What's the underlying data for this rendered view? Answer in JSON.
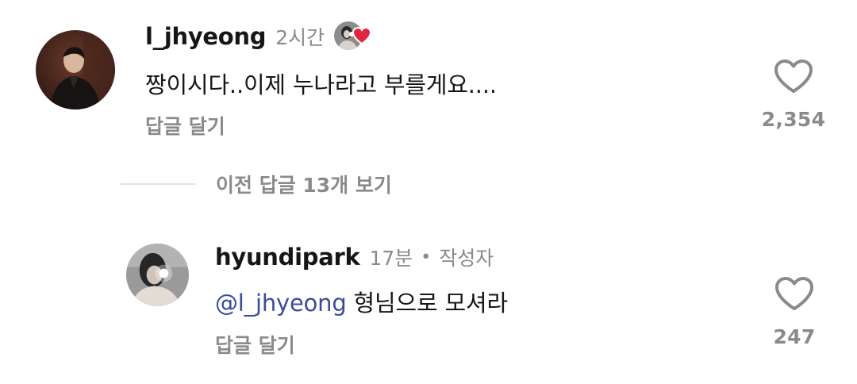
{
  "comment": {
    "username": "l_jhyeong",
    "time": "2시간",
    "text": "짱이시다..이제 누나라고 부를게요....",
    "reply_label": "답글 달기",
    "like_count": "2,354",
    "creator_liked_icon": "heart-icon"
  },
  "more_replies": {
    "label": "이전 답글 13개 보기"
  },
  "reply": {
    "username": "hyundipark",
    "time": "17분",
    "separator": "•",
    "author_tag": "작성자",
    "mention": "@l_jhyeong",
    "text": " 형님으로 모셔라",
    "reply_label": "답글 달기",
    "like_count": "247"
  },
  "colors": {
    "mention": "#3b4b9c",
    "secondary_text": "#8a8a8a",
    "liked_heart": "#e0253f"
  }
}
